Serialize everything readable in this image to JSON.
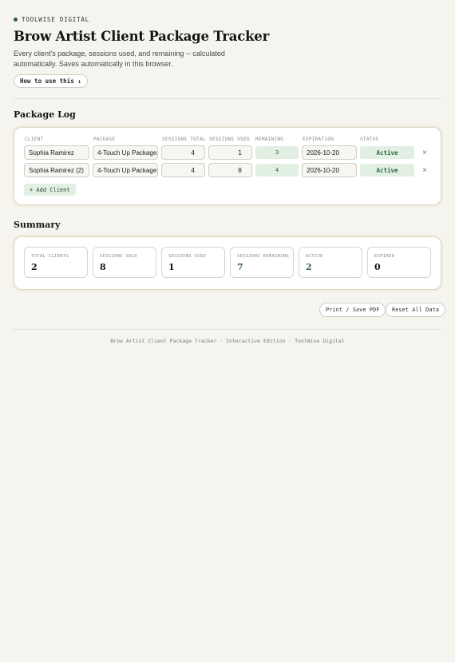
{
  "brand": {
    "name": "TOOLWISE DIGITAL"
  },
  "page": {
    "title": "Brow Artist Client Package Tracker",
    "description": "Every client's package, sessions used, and remaining -- calculated automatically. Saves automatically in this browser.",
    "how_to_label": "How to use this ↓"
  },
  "package_log": {
    "title": "Package Log",
    "columns": {
      "client": "CLIENT",
      "package": "PACKAGE",
      "sessions_total": "SESSIONS TOTAL",
      "sessions_used": "SESSIONS USED",
      "remaining": "REMAINING",
      "expiration": "EXPIRATION",
      "status": "STATUS"
    },
    "rows": [
      {
        "client": "Sophia Ramirez",
        "package": "4-Touch Up Package",
        "sessions_total": "4",
        "sessions_used": "1",
        "remaining": "3",
        "expiration": "2026-10-20",
        "status": "Active",
        "remove": "×"
      },
      {
        "client": "Sophia Ramirez (2)",
        "package": "4-Touch Up Package",
        "sessions_total": "4",
        "sessions_used": "0",
        "remaining": "4",
        "expiration": "2026-10-20",
        "status": "Active",
        "remove": "×"
      }
    ],
    "add_label": "+ Add Client"
  },
  "summary": {
    "title": "Summary",
    "stats": [
      {
        "label": "TOTAL CLIENTS",
        "value": "2"
      },
      {
        "label": "SESSIONS SOLD",
        "value": "8"
      },
      {
        "label": "SESSIONS USED",
        "value": "1"
      },
      {
        "label": "SESSIONS REMAINING",
        "value": "7"
      },
      {
        "label": "ACTIVE",
        "value": "2"
      },
      {
        "label": "EXPIRED",
        "value": "0"
      }
    ]
  },
  "actions": {
    "print_label": "Print / Save PDF",
    "reset_label": "Reset All Data"
  },
  "footer": {
    "text": "Brow Artist Client Package Tracker · Interactive Edition · ToolWise Digital"
  },
  "colors": {
    "accent": "#2f5e3f",
    "accent_bg": "#e2efe3",
    "background": "#f5f4ee"
  }
}
